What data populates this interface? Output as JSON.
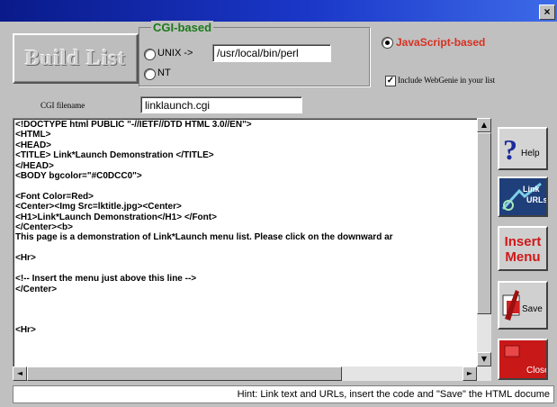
{
  "window": {
    "close_label": "×"
  },
  "build_button": {
    "label": "Build List"
  },
  "cgi_group": {
    "label": "CGI-based",
    "unix_label": "UNIX ->",
    "unix_path": "/usr/local/bin/perl",
    "nt_label": "NT",
    "selected": "javascript"
  },
  "javascript_option": {
    "label": "JavaScript-based",
    "selected": true
  },
  "include_webgenie": {
    "label": "Include WebGenie in your list",
    "checked": true
  },
  "cgi_filename": {
    "label": "CGI filename",
    "value": "linklaunch.cgi"
  },
  "editor": {
    "lines": [
      "<!DOCTYPE html PUBLIC \"-//IETF//DTD HTML 3.0//EN\">",
      "<HTML>",
      "<HEAD>",
      "<TITLE> Link*Launch Demonstration </TITLE>",
      "</HEAD>",
      "<BODY bgcolor=\"#C0DCC0\">",
      "",
      "<Font Color=Red>",
      "<Center><Img Src=lktitle.jpg><Center>",
      "<H1>Link*Launch Demonstration</H1> </Font>",
      "</Center><b>",
      "This page is a demonstration of Link*Launch menu list. Please click on the downward ar",
      "",
      "<Hr>",
      "",
      "<!-- Insert the menu just above this line -->",
      "</Center>",
      "",
      "",
      "",
      "<Hr>"
    ]
  },
  "side_buttons": {
    "help": "Help",
    "link_urls": "Link URLs",
    "insert_menu": "Insert Menu",
    "save": "Save",
    "close": "Close"
  },
  "status_hint": "Hint: Link text and URLs, insert the code and \"Save\" the HTML docume",
  "colors": {
    "title_bar": "#1a37c8",
    "cgi_label": "#1a7a1a",
    "javascript_label": "#d83020",
    "insert_menu_text": "#d01818"
  }
}
